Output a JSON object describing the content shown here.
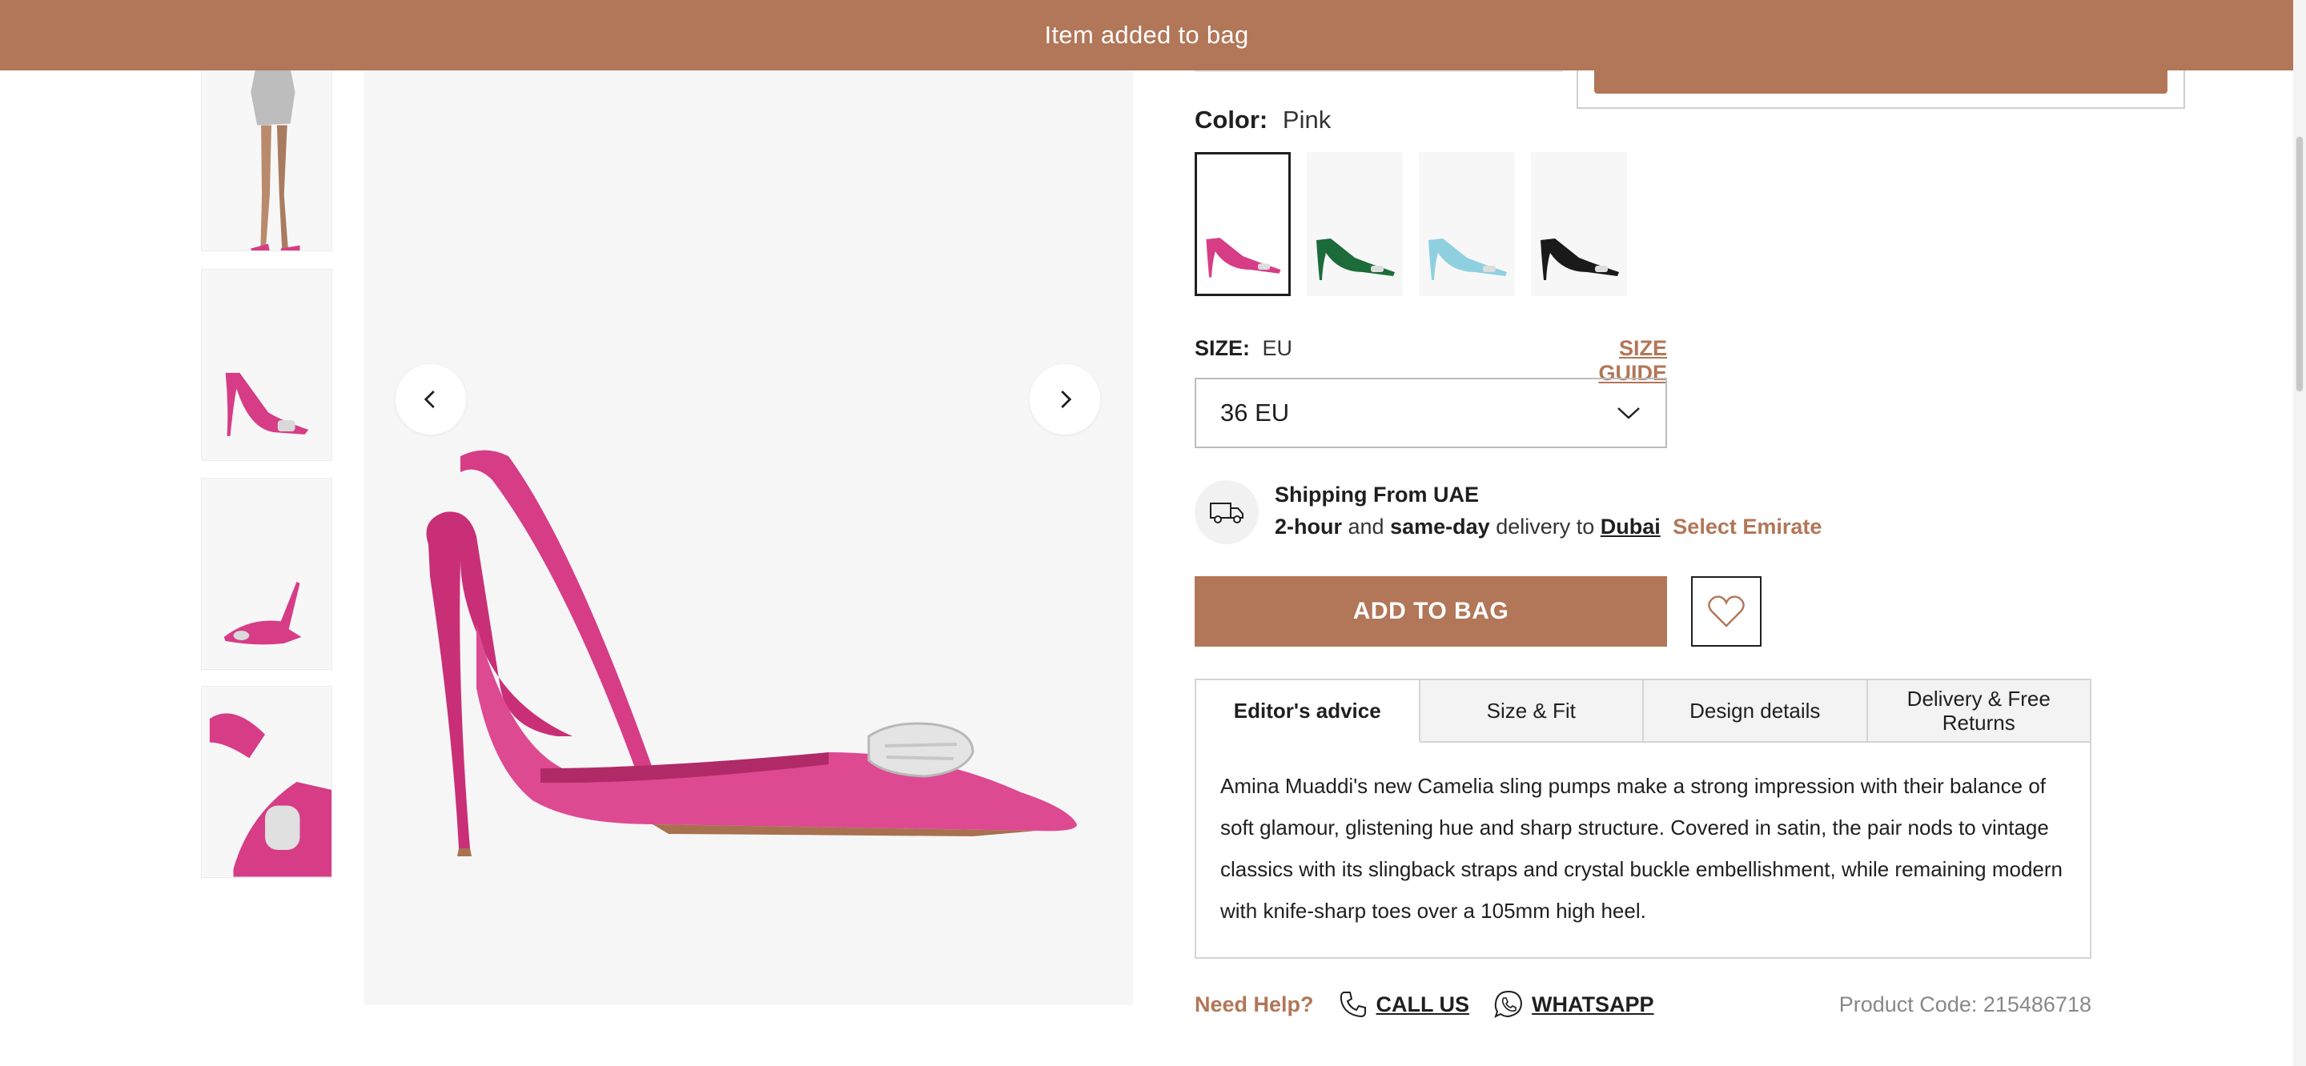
{
  "toast": {
    "message": "Item added to bag"
  },
  "product": {
    "color_label": "Color:",
    "color_value": "Pink",
    "swatches": [
      {
        "name": "Pink",
        "color": "#d63d86"
      },
      {
        "name": "Green",
        "color": "#1c6b3a"
      },
      {
        "name": "Light Blue",
        "color": "#8fd0e0"
      },
      {
        "name": "Black",
        "color": "#1a1a1a"
      }
    ],
    "size_label": "SIZE:",
    "size_unit": "EU",
    "size_guide": "SIZE GUIDE",
    "size_selected": "36 EU",
    "shipping_title": "Shipping From UAE",
    "shipping_bold1": "2-hour",
    "shipping_and": "and",
    "shipping_bold2": "same-day",
    "shipping_delivery": "delivery to",
    "shipping_city": "Dubai",
    "shipping_select": "Select Emirate",
    "add_to_bag": "ADD TO BAG",
    "product_code": "Product Code: 215486718"
  },
  "tabs": [
    {
      "label": "Editor's advice",
      "active": true
    },
    {
      "label": "Size & Fit"
    },
    {
      "label": "Design details"
    },
    {
      "label": "Delivery & Free Returns"
    }
  ],
  "editor_advice": "Amina Muaddi's new Camelia sling pumps make a strong impression with their balance of soft glamour, glistening hue and sharp structure. Covered in satin, the pair nods to vintage classics with its slingback straps and crystal buckle embellishment, while remaining modern with knife-sharp toes over a 105mm high heel.",
  "help": {
    "need_help": "Need Help?",
    "call_us": "CALL US",
    "whatsapp": "WHATSAPP"
  },
  "colors": {
    "accent": "#b27658",
    "shoe_pink": "#d63d86"
  },
  "icons": [
    "chevron-left-icon",
    "chevron-right-icon",
    "chevron-down-icon",
    "delivery-truck-icon",
    "heart-icon",
    "phone-icon",
    "whatsapp-icon"
  ]
}
